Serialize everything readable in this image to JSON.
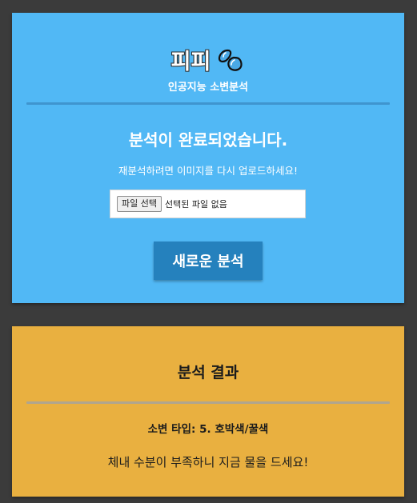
{
  "header": {
    "brand": "피피",
    "logo_icon": "water-drops-icon",
    "subtitle": "인공지능 소변분석"
  },
  "status": {
    "title": "분석이 완료되었습니다.",
    "message": "재분석하려면 이미지를 다시 업로드하세요!"
  },
  "upload": {
    "button_label": "파일 선택",
    "status_text": "선택된 파일 없음"
  },
  "actions": {
    "new_analysis_label": "새로운 분석"
  },
  "result": {
    "title": "분석 결과",
    "type_line": "소변 타입: 5. 호박색/꿀색",
    "advice": "체내 수분이 부족하니 지금 물을 드세요!"
  },
  "colors": {
    "background": "#3b3b3b",
    "top_card": "#51b8f5",
    "result_card": "#e9b040",
    "button": "#2581bd"
  }
}
